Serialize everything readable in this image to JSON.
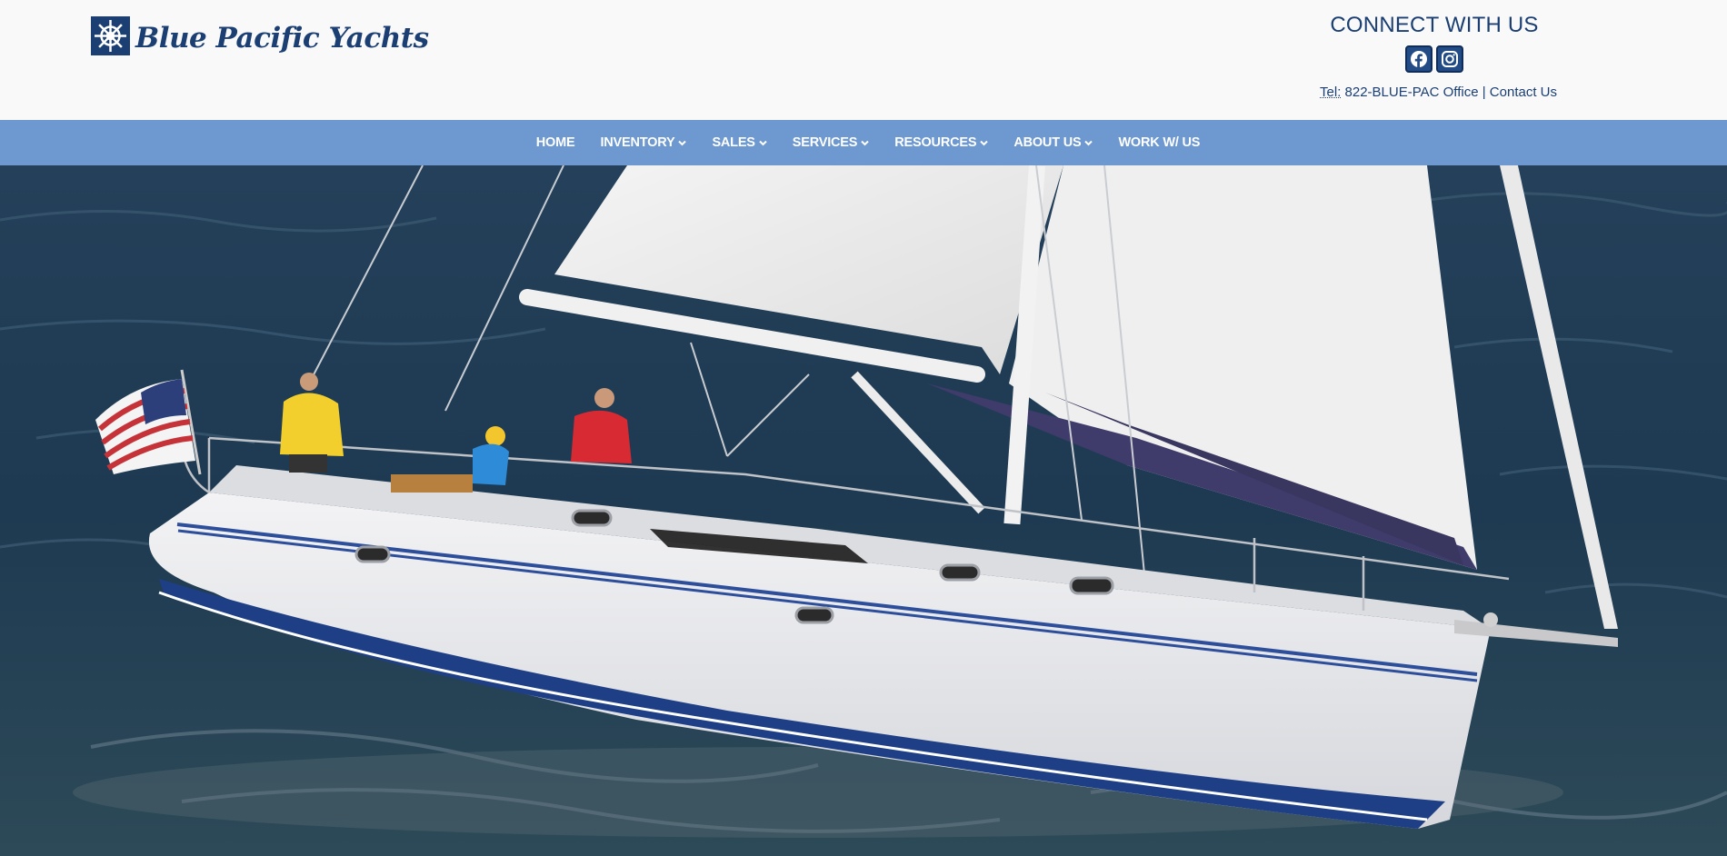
{
  "brand": {
    "name": "Blue Pacific Yachts",
    "logo_icon": "ship-wheel-icon",
    "color": "#1b3f73"
  },
  "connect": {
    "title": "CONNECT WITH US",
    "social": [
      {
        "name": "facebook",
        "icon": "facebook-icon"
      },
      {
        "name": "instagram",
        "icon": "instagram-icon"
      }
    ],
    "tel_label": "Tel:",
    "tel_value": "822-BLUE-PAC Office",
    "separator": "|",
    "contact_link": "Contact Us"
  },
  "nav": {
    "background": "#6d98d0",
    "items": [
      {
        "label": "HOME",
        "dropdown": false
      },
      {
        "label": "INVENTORY",
        "dropdown": true
      },
      {
        "label": "SALES",
        "dropdown": true
      },
      {
        "label": "SERVICES",
        "dropdown": true
      },
      {
        "label": "RESOURCES",
        "dropdown": true
      },
      {
        "label": "ABOUT US",
        "dropdown": true
      },
      {
        "label": "WORK W/ US",
        "dropdown": false
      }
    ]
  },
  "hero": {
    "subject": "sailboat-photo",
    "colors": {
      "sea": "#1f3b55",
      "hull": "#e8e8ea",
      "stripe": "#1d3e8f",
      "sail": "#f0f0f0"
    }
  }
}
